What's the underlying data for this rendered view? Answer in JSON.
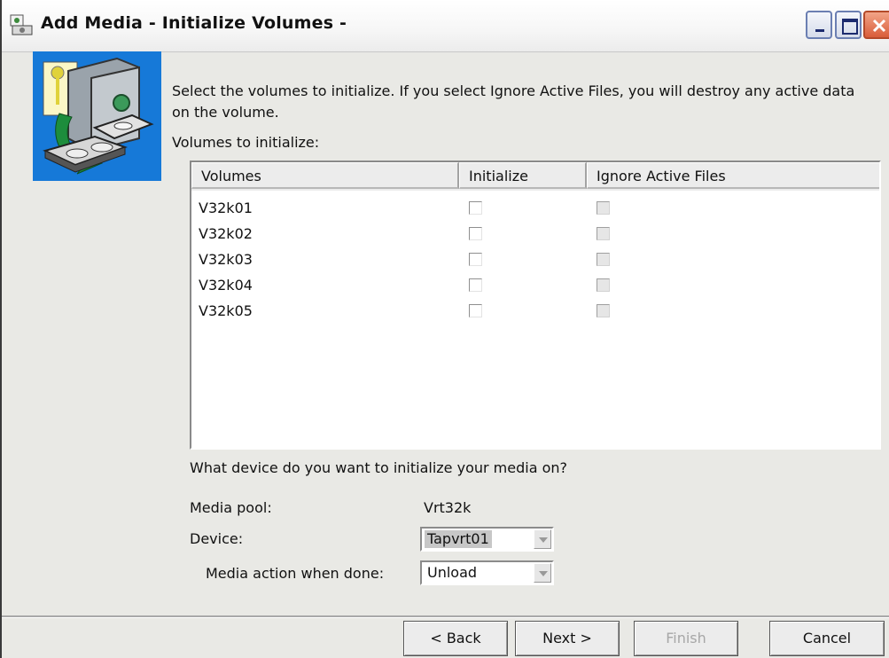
{
  "window": {
    "title": "Add Media - Initialize Volumes -"
  },
  "intro": {
    "instruction": "Select the volumes to initialize. If you select Ignore Active Files, you will destroy any active data on the volume.",
    "volumes_label": "Volumes to initialize:"
  },
  "table": {
    "columns": [
      "Volumes",
      "Initialize",
      "Ignore Active Files"
    ],
    "rows": [
      {
        "volume": "V32k01",
        "initialize": false,
        "ignore_active_files": false
      },
      {
        "volume": "V32k02",
        "initialize": false,
        "ignore_active_files": false
      },
      {
        "volume": "V32k03",
        "initialize": false,
        "ignore_active_files": false
      },
      {
        "volume": "V32k04",
        "initialize": false,
        "ignore_active_files": false
      },
      {
        "volume": "V32k05",
        "initialize": false,
        "ignore_active_files": false
      }
    ]
  },
  "device_section": {
    "question": "What device do you want to initialize your media on?",
    "media_pool_label": "Media pool:",
    "media_pool_value": "Vrt32k",
    "device_label": "Device:",
    "device_value": "Tapvrt01",
    "media_action_label": "Media action when done:",
    "media_action_value": "Unload"
  },
  "buttons": {
    "back": "< Back",
    "next": "Next >",
    "finish": "Finish",
    "cancel": "Cancel"
  },
  "colors": {
    "hero_bg": "#1679d8",
    "window_bg": "#e9e9e5",
    "close_button": "#d95d3a"
  }
}
